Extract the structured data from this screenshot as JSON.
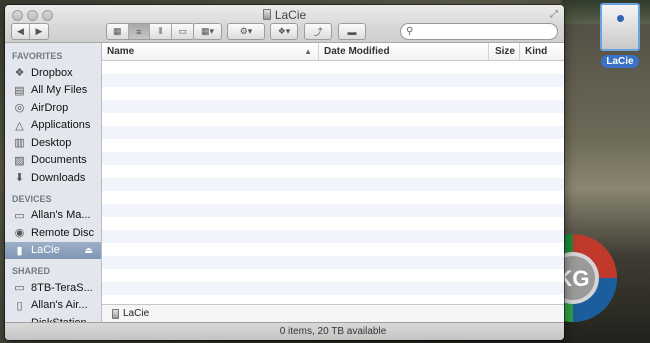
{
  "window": {
    "title": "LaCie",
    "search_placeholder": ""
  },
  "sidebar": {
    "sections": [
      {
        "heading": "FAVORITES",
        "items": [
          {
            "label": "Dropbox",
            "icon": "dropbox-icon"
          },
          {
            "label": "All My Files",
            "icon": "all-files-icon"
          },
          {
            "label": "AirDrop",
            "icon": "airdrop-icon"
          },
          {
            "label": "Applications",
            "icon": "applications-icon"
          },
          {
            "label": "Desktop",
            "icon": "desktop-icon"
          },
          {
            "label": "Documents",
            "icon": "documents-icon"
          },
          {
            "label": "Downloads",
            "icon": "downloads-icon"
          }
        ]
      },
      {
        "heading": "DEVICES",
        "items": [
          {
            "label": "Allan's Ma...",
            "icon": "computer-icon"
          },
          {
            "label": "Remote Disc",
            "icon": "disc-icon"
          },
          {
            "label": "LaCie",
            "icon": "drive-icon",
            "selected": true
          }
        ]
      },
      {
        "heading": "SHARED",
        "items": [
          {
            "label": "8TB-TeraS...",
            "icon": "network-display-icon"
          },
          {
            "label": "Allan's Air...",
            "icon": "network-computer-icon"
          },
          {
            "label": "DiskStation",
            "icon": "network-server-icon"
          }
        ]
      }
    ]
  },
  "columns": {
    "name": "Name",
    "date": "Date Modified",
    "size": "Size",
    "kind": "Kind"
  },
  "path_bar": {
    "label": "LaCie"
  },
  "status": {
    "text": "0 items, 20 TB available"
  },
  "desktop": {
    "drive_label": "LaCie"
  },
  "logo": {
    "text": "KG"
  },
  "colors": {
    "selection": "#8a9fbb",
    "sidebar_bg": "#e3e7ed",
    "desktop_label_bg": "#3b72c7"
  }
}
